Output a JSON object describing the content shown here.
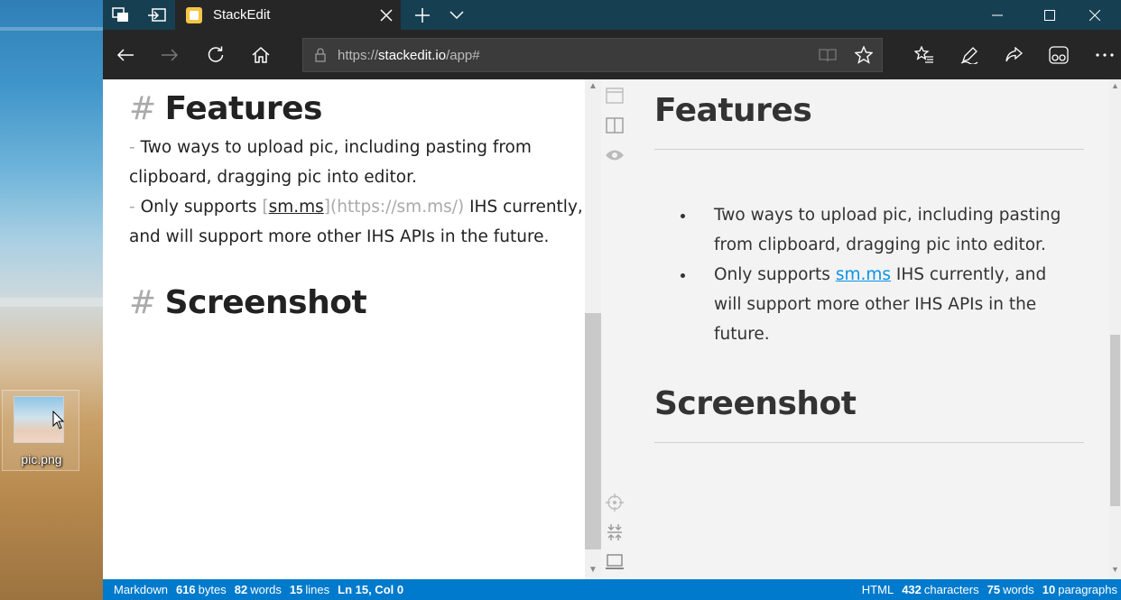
{
  "desktop": {
    "icon_label": "pic.png"
  },
  "browser": {
    "tab_title": "StackEdit",
    "url_prefix": "https://",
    "url_host": "stackedit.io",
    "url_path": "/app#",
    "icons": [
      "tab-actions-icon",
      "set-aside-tabs-icon",
      "new-tab-icon",
      "tab-list-chevron-icon",
      "back-icon",
      "forward-icon",
      "refresh-icon",
      "home-icon",
      "lock-icon",
      "reading-view-icon",
      "favorite-star-icon",
      "favorites-hub-icon",
      "pen-icon",
      "share-icon",
      "extension-icon",
      "more-icon"
    ]
  },
  "editor": {
    "hash": "#",
    "h1_features": "Features",
    "line1_dash": "- ",
    "line1_text": "Two ways to upload pic, including pasting from",
    "line2_text": "clipboard, dragging pic into editor.",
    "line3_dash": "- ",
    "line3_text": "Only supports ",
    "line3_bracket_open": "[",
    "line3_link": "sm.ms",
    "line3_bracket_close": "]",
    "line3_url": "(https://sm.ms/)",
    "line3_after": " IHS currently,",
    "line4_text": "and will support more other IHS APIs in the future.",
    "h1_screenshot": "Screenshot"
  },
  "preview": {
    "h1_features": "Features",
    "bullet1": "Two ways to upload pic, including pasting from clipboard, dragging pic into editor.",
    "bullet2_before": "Only supports ",
    "bullet2_link": "sm.ms",
    "bullet2_after": " IHS currently, and will support more other IHS APIs in the future.",
    "h1_screenshot": "Screenshot"
  },
  "statusbar": {
    "left_label": "Markdown",
    "bytes_value": "616",
    "bytes_unit": "bytes",
    "words_value": "82",
    "words_unit": "words",
    "lines_value": "15",
    "lines_unit": "lines",
    "cursor_pos": "Ln 15, Col 0",
    "right_label": "HTML",
    "chars_value": "432",
    "chars_unit": "characters",
    "pwords_value": "75",
    "pwords_unit": "words",
    "paras_value": "10",
    "paras_unit": "paragraphs"
  },
  "colors": {
    "statusbar": "#007acc",
    "link": "#0c93e4",
    "titlebar": "#173f52",
    "navbar": "#262626"
  }
}
